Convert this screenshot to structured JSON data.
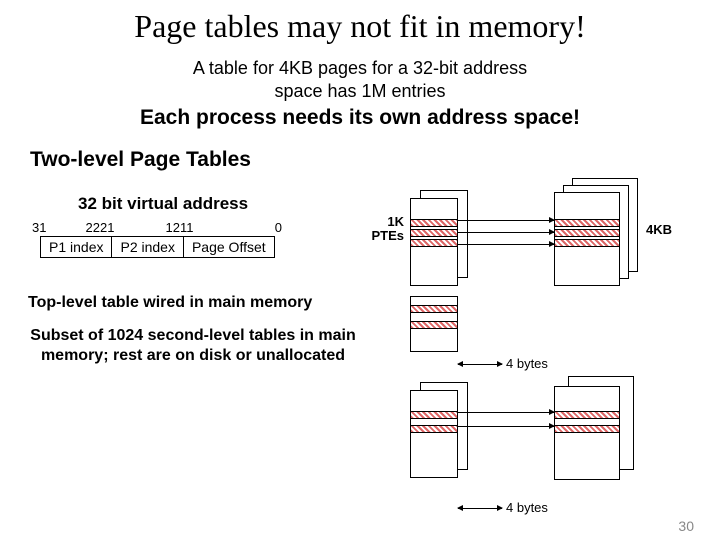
{
  "title": "Page tables may not fit in memory!",
  "subtitle_l1": "A table for 4KB pages for a 32-bit address",
  "subtitle_l2": "space has 1M entries",
  "emph": "Each process needs its own address space!",
  "section": "Two-level Page Tables",
  "va_label": "32 bit virtual address",
  "bits": {
    "b31": "31",
    "b22": "22",
    "b21": "21",
    "b12": "12",
    "b11": "11",
    "b0": "0"
  },
  "cols": {
    "p1": "P1 index",
    "p2": "P2 index",
    "off": "Page Offset"
  },
  "para1": "Top-level table wired in main memory",
  "para2": "Subset of 1024 second-level tables in main memory; rest are on disk or unallocated",
  "labels": {
    "ptes": "1K",
    "ptes2": "PTEs",
    "kb": "4KB",
    "bytes": "4 bytes"
  },
  "page": "30"
}
